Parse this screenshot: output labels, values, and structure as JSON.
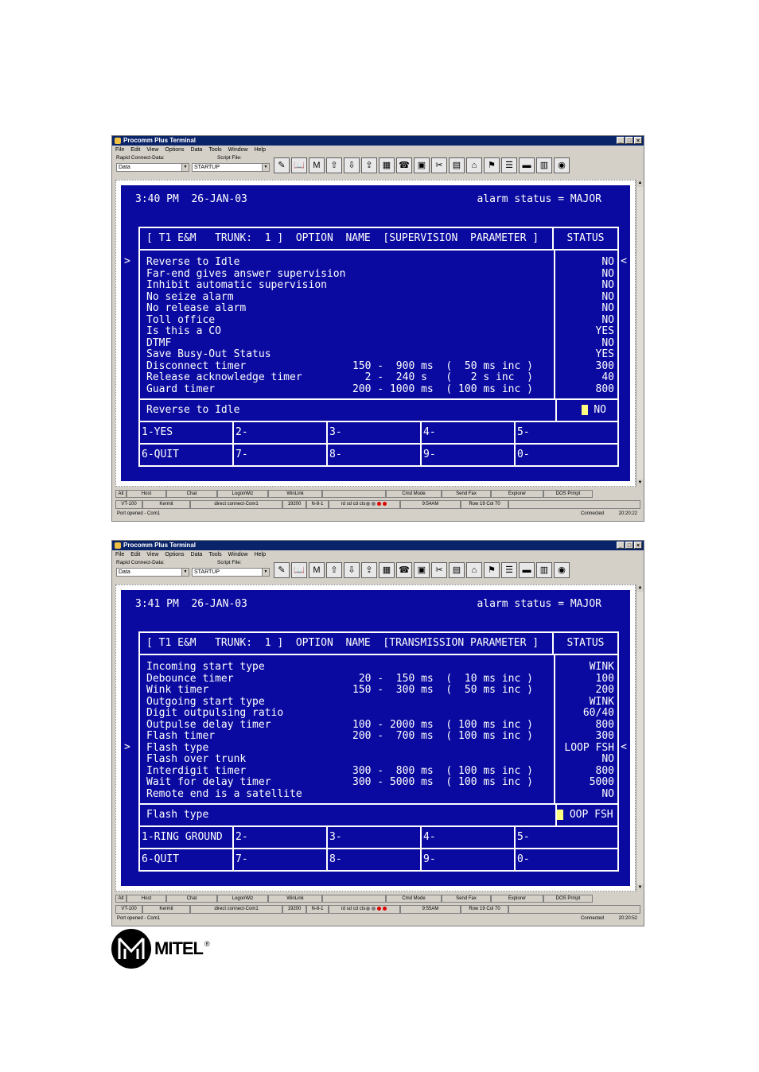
{
  "windows": [
    {
      "title": "Procomm Plus Terminal",
      "menu": [
        "File",
        "Edit",
        "View",
        "Options",
        "Data",
        "Tools",
        "Window",
        "Help"
      ],
      "rapid_label": "Rapid Connect-Data:",
      "script_label": "Script File:",
      "rapid_value": "Data",
      "script_value": "STARTUP",
      "time": "3:40 PM  26-JAN-03",
      "alarm": "alarm status = MAJOR",
      "header": "[ T1 E&M   TRUNK:  1 ]  OPTION  NAME  [SUPERVISION  PARAMETER ]",
      "status_header": "STATUS",
      "pointer_row": 0,
      "rows": [
        {
          "label": "Reverse to Idle",
          "range": "",
          "value": "NO"
        },
        {
          "label": "Far-end gives answer supervision",
          "range": "",
          "value": "NO"
        },
        {
          "label": "Inhibit automatic supervision",
          "range": "",
          "value": "NO"
        },
        {
          "label": "No seize alarm",
          "range": "",
          "value": "NO"
        },
        {
          "label": "No release alarm",
          "range": "",
          "value": "NO"
        },
        {
          "label": "Toll office",
          "range": "",
          "value": "NO"
        },
        {
          "label": "Is this a CO",
          "range": "",
          "value": "YES"
        },
        {
          "label": "DTMF",
          "range": "",
          "value": "NO"
        },
        {
          "label": "Save Busy-Out Status",
          "range": "",
          "value": "YES"
        },
        {
          "label": "Disconnect timer",
          "range": "150 -  900 ms  (  50 ms inc )",
          "value": "300"
        },
        {
          "label": "Release acknowledge timer",
          "range": "  2 -  240 s   (   2 s inc  )",
          "value": "40"
        },
        {
          "label": "Guard timer",
          "range": "200 - 1000 ms  ( 100 ms inc )",
          "value": "800"
        }
      ],
      "current_label": "Reverse to Idle",
      "current_value": "NO",
      "options": [
        "1-YES",
        "2-",
        "3-",
        "4-",
        "5-",
        "6-QUIT",
        "7-",
        "8-",
        "9-",
        "0-"
      ],
      "statusbar1": [
        "Alt",
        "Host",
        "Chat",
        "LogonWiz",
        "WinLink",
        "",
        "Cmd Mode",
        "Send Fax",
        "Explorer",
        "DOS Prmpt"
      ],
      "term": "VT-100",
      "kermit": "Kermit",
      "connect": "direct connect-Com1",
      "baud": "19200",
      "parity": "N-8-1",
      "signals": "rd  sd  cd  cts",
      "clock": "9:54AM",
      "rowcol": "Row 19   Col 70",
      "port_msg": "Port opened - Com1",
      "connected": "Connected",
      "elapsed": "20:20:22"
    },
    {
      "title": "Procomm Plus Terminal",
      "menu": [
        "File",
        "Edit",
        "View",
        "Options",
        "Data",
        "Tools",
        "Window",
        "Help"
      ],
      "rapid_label": "Rapid Connect-Data:",
      "script_label": "Script File:",
      "rapid_value": "Data",
      "script_value": "STARTUP",
      "time": "3:41 PM  26-JAN-03",
      "alarm": "alarm status = MAJOR",
      "header": "[ T1 E&M   TRUNK:  1 ]  OPTION  NAME  [TRANSMISSION PARAMETER ]",
      "status_header": "STATUS",
      "pointer_row": 7,
      "rows": [
        {
          "label": "Incoming start type",
          "range": "",
          "value": "WINK"
        },
        {
          "label": "Debounce timer",
          "range": " 20 -  150 ms  (  10 ms inc )",
          "value": "100"
        },
        {
          "label": "Wink timer",
          "range": "150 -  300 ms  (  50 ms inc )",
          "value": "200"
        },
        {
          "label": "Outgoing start type",
          "range": "",
          "value": "WINK"
        },
        {
          "label": "Digit outpulsing ratio",
          "range": "",
          "value": "60/40"
        },
        {
          "label": "Outpulse delay timer",
          "range": "100 - 2000 ms  ( 100 ms inc )",
          "value": "800"
        },
        {
          "label": "Flash timer",
          "range": "200 -  700 ms  ( 100 ms inc )",
          "value": "300"
        },
        {
          "label": "Flash type",
          "range": "",
          "value": "LOOP FSH"
        },
        {
          "label": "Flash over trunk",
          "range": "",
          "value": "NO"
        },
        {
          "label": "Interdigit timer",
          "range": "300 -  800 ms  ( 100 ms inc )",
          "value": "800"
        },
        {
          "label": "Wait for delay timer",
          "range": "300 - 5000 ms  ( 100 ms inc )",
          "value": "5000"
        },
        {
          "label": "Remote end is a satellite",
          "range": "",
          "value": "NO"
        }
      ],
      "current_label": "Flash type",
      "current_value": "OOP FSH",
      "options": [
        "1-RING GROUND",
        "2-",
        "3-",
        "4-",
        "5-",
        "6-QUIT",
        "7-",
        "8-",
        "9-",
        "0-"
      ],
      "statusbar1": [
        "Alt",
        "Host",
        "Chat",
        "LogonWiz",
        "WinLink",
        "",
        "Cmd Mode",
        "Send Fax",
        "Explorer",
        "DOS Prmpt"
      ],
      "term": "VT-100",
      "kermit": "Kermit",
      "connect": "direct connect-Com1",
      "baud": "19200",
      "parity": "N-8-1",
      "signals": "rd  sd  cd  cts",
      "clock": "9:55AM",
      "rowcol": "Row 19   Col 70",
      "port_msg": "Port opened - Com1",
      "connected": "Connected",
      "elapsed": "20:20:52"
    }
  ],
  "logo": {
    "word": "MITEL",
    "reg": "®"
  }
}
